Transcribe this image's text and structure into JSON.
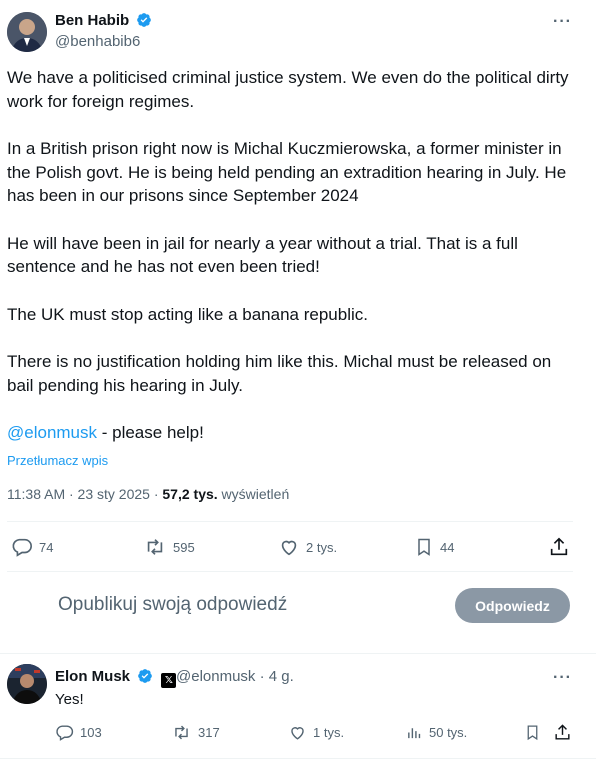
{
  "post": {
    "author_name": "Ben Habib",
    "author_handle": "@benhabib6",
    "more_label": "···",
    "paragraphs": [
      "We have a politicised criminal justice system. We even do the political dirty work for foreign regimes.",
      "In a British prison right now is Michal Kuczmierowska, a former minister in the Polish govt. He is being held pending an extradition hearing in July. He has been in our prisons since September 2024",
      "He will have been in jail for nearly a year without a trial. That is a full sentence and he has not even been tried!",
      "The UK must stop acting like a banana republic.",
      "There is no justification holding him like this. Michal must be released on bail pending his hearing in July."
    ],
    "mention": "@elonmusk",
    "mention_suffix": " - please help!",
    "translate_label": "Przetłumacz wpis",
    "timestamp": "11:38 AM · 23 sty 2025 · ",
    "views_count": "57,2 tys.",
    "views_label": " wyświetleń",
    "stats": {
      "replies": "74",
      "reposts": "595",
      "likes": "2 tys.",
      "bookmarks": "44"
    }
  },
  "composer": {
    "placeholder": "Opublikuj swoją odpowiedź",
    "reply_button": "Odpowiedz"
  },
  "reply": {
    "author_name": "Elon Musk",
    "author_handle": "@elonmusk · 4 g.",
    "text": "Yes!",
    "more_label": "···",
    "stats": {
      "replies": "103",
      "reposts": "317",
      "likes": "1 tys.",
      "views": "50 tys."
    }
  },
  "colors": {
    "accent": "#1d9bf0",
    "muted": "#536471",
    "text": "#0f1419",
    "button_disabled": "#8b98a5"
  },
  "icons": [
    "verified-badge-icon",
    "more-icon",
    "reply-icon",
    "repost-icon",
    "like-icon",
    "bookmark-icon",
    "share-icon",
    "views-icon",
    "x-logo-icon"
  ]
}
